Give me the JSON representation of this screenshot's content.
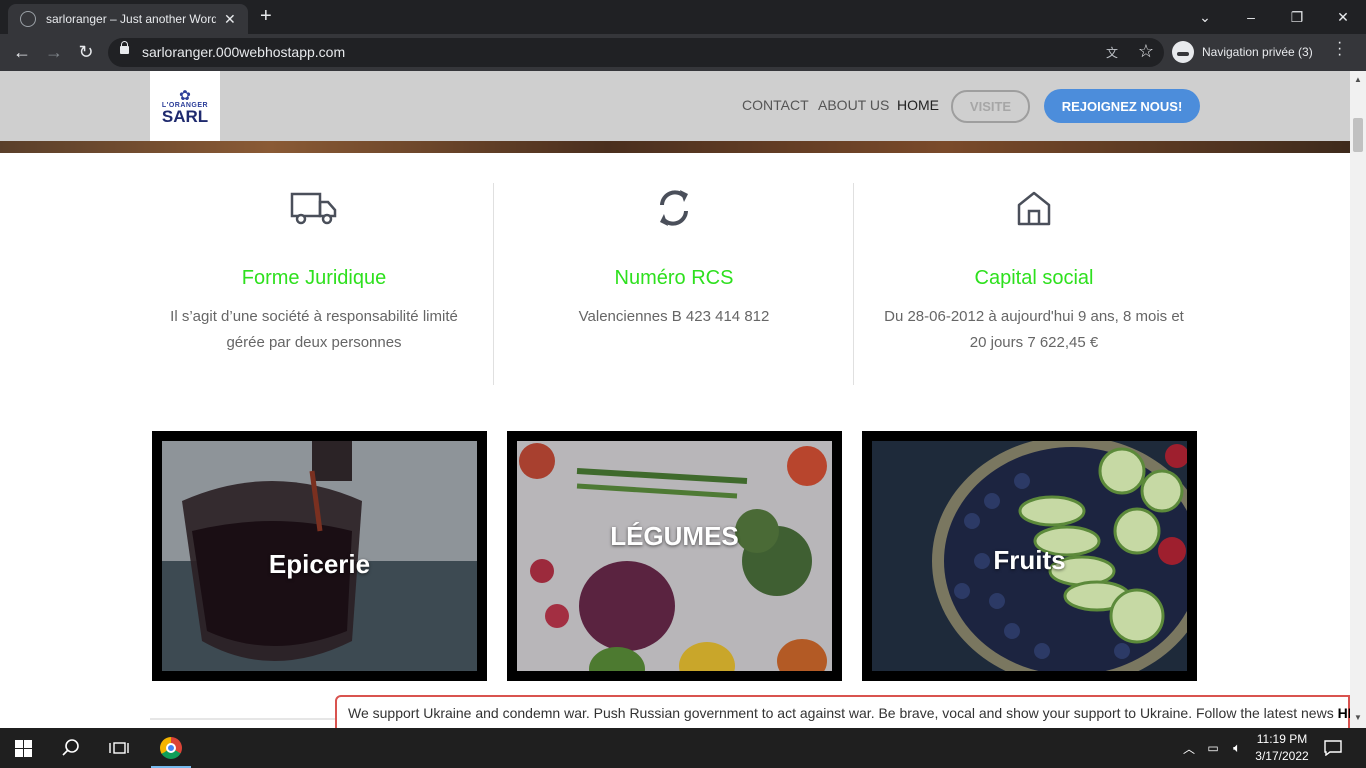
{
  "browser": {
    "tab_title": "sarloranger – Just another WordP",
    "url": "sarloranger.000webhostapp.com",
    "incognito_label": "Navigation privée (3)"
  },
  "site": {
    "logo": {
      "line1": "L'ORANGER",
      "line2": "SARL"
    },
    "nav": {
      "contact": "CONTACT",
      "about": "ABOUT US",
      "home": "HOME",
      "visite": "VISITE",
      "join": "REJOIGNEZ NOUS!"
    },
    "features": [
      {
        "icon": "truck-icon",
        "title": "Forme Juridique",
        "text": "Il s’agit d’une société à responsabilité limité gérée par deux personnes"
      },
      {
        "icon": "refresh-icon",
        "title": "Numéro RCS",
        "text": "Valenciennes B 423 414 812"
      },
      {
        "icon": "home-icon",
        "title": "Capital social",
        "text": "Du 28-06-2012 à aujourd'hui 9 ans, 8 mois et 20 jours 7 622,45 €"
      }
    ],
    "categories": [
      {
        "label": "Epicerie"
      },
      {
        "label": "LÉGUMES"
      },
      {
        "label": "Fruits"
      }
    ],
    "notice": {
      "text": "We support Ukraine and condemn war. Push Russian government to act against war. Be brave, vocal and show your support to Ukraine. Follow the latest news ",
      "link": "HERE"
    }
  },
  "taskbar": {
    "time": "11:19 PM",
    "date": "3/17/2022"
  },
  "colors": {
    "feature_title": "#2ee01e",
    "join_button": "#4c8ddb",
    "notice_border": "#d9534f"
  }
}
